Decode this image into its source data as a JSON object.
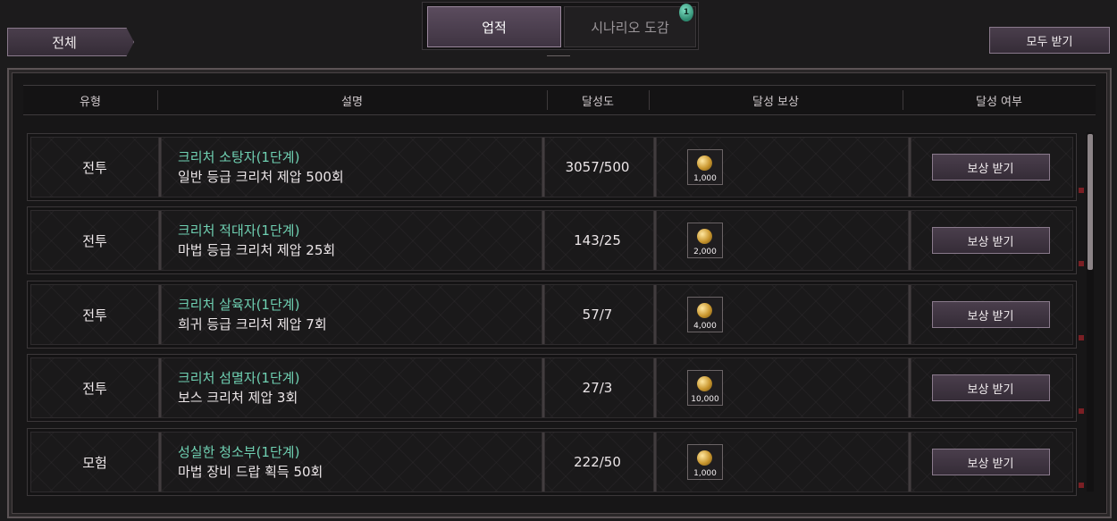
{
  "filter": {
    "label": "전체"
  },
  "tabs": [
    {
      "label": "업적",
      "active": true
    },
    {
      "label": "시나리오 도감",
      "active": false
    }
  ],
  "tab_badge": "1",
  "receive_all_label": "모두 받기",
  "table": {
    "headers": [
      "유형",
      "설명",
      "달성도",
      "달성 보상",
      "달성 여부"
    ],
    "rows": [
      {
        "type": "전투",
        "title": "크리처 소탕자(1단계)",
        "desc": "일반 등급 크리처 제압 500회",
        "progress": "3057/500",
        "reward_amount": "1,000",
        "reward_icon": "gold-coin-icon",
        "action": "보상 받기"
      },
      {
        "type": "전투",
        "title": "크리처 적대자(1단계)",
        "desc": "마법 등급 크리처 제압 25회",
        "progress": "143/25",
        "reward_amount": "2,000",
        "reward_icon": "gold-coin-icon",
        "action": "보상 받기"
      },
      {
        "type": "전투",
        "title": "크리처 살육자(1단계)",
        "desc": "희귀 등급 크리처 제압 7회",
        "progress": "57/7",
        "reward_amount": "4,000",
        "reward_icon": "gold-coin-icon",
        "action": "보상 받기"
      },
      {
        "type": "전투",
        "title": "크리처 섬멸자(1단계)",
        "desc": "보스 크리처 제압 3회",
        "progress": "27/3",
        "reward_amount": "10,000",
        "reward_icon": "gold-coin-icon",
        "action": "보상 받기"
      },
      {
        "type": "모험",
        "title": "성실한 청소부(1단계)",
        "desc": "마법 장비 드랍 획득 50회",
        "progress": "222/50",
        "reward_amount": "1,000",
        "reward_icon": "gold-coin-icon",
        "action": "보상 받기"
      }
    ]
  },
  "colors": {
    "title_accent": "#6fd0b2",
    "button_bg": "#3f3442",
    "background": "#1c1b1c"
  }
}
